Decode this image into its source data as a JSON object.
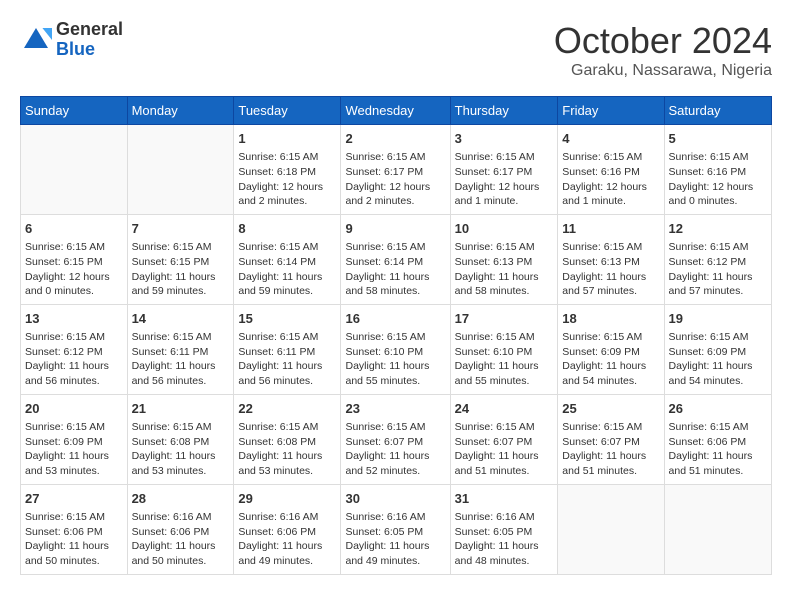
{
  "header": {
    "logo_general": "General",
    "logo_blue": "Blue",
    "title": "October 2024",
    "location": "Garaku, Nassarawa, Nigeria"
  },
  "days_of_week": [
    "Sunday",
    "Monday",
    "Tuesday",
    "Wednesday",
    "Thursday",
    "Friday",
    "Saturday"
  ],
  "weeks": [
    [
      {
        "day": "",
        "sunrise": "",
        "sunset": "",
        "daylight": "",
        "empty": true
      },
      {
        "day": "",
        "sunrise": "",
        "sunset": "",
        "daylight": "",
        "empty": true
      },
      {
        "day": "1",
        "sunrise": "Sunrise: 6:15 AM",
        "sunset": "Sunset: 6:18 PM",
        "daylight": "Daylight: 12 hours and 2 minutes."
      },
      {
        "day": "2",
        "sunrise": "Sunrise: 6:15 AM",
        "sunset": "Sunset: 6:17 PM",
        "daylight": "Daylight: 12 hours and 2 minutes."
      },
      {
        "day": "3",
        "sunrise": "Sunrise: 6:15 AM",
        "sunset": "Sunset: 6:17 PM",
        "daylight": "Daylight: 12 hours and 1 minute."
      },
      {
        "day": "4",
        "sunrise": "Sunrise: 6:15 AM",
        "sunset": "Sunset: 6:16 PM",
        "daylight": "Daylight: 12 hours and 1 minute."
      },
      {
        "day": "5",
        "sunrise": "Sunrise: 6:15 AM",
        "sunset": "Sunset: 6:16 PM",
        "daylight": "Daylight: 12 hours and 0 minutes."
      }
    ],
    [
      {
        "day": "6",
        "sunrise": "Sunrise: 6:15 AM",
        "sunset": "Sunset: 6:15 PM",
        "daylight": "Daylight: 12 hours and 0 minutes."
      },
      {
        "day": "7",
        "sunrise": "Sunrise: 6:15 AM",
        "sunset": "Sunset: 6:15 PM",
        "daylight": "Daylight: 11 hours and 59 minutes."
      },
      {
        "day": "8",
        "sunrise": "Sunrise: 6:15 AM",
        "sunset": "Sunset: 6:14 PM",
        "daylight": "Daylight: 11 hours and 59 minutes."
      },
      {
        "day": "9",
        "sunrise": "Sunrise: 6:15 AM",
        "sunset": "Sunset: 6:14 PM",
        "daylight": "Daylight: 11 hours and 58 minutes."
      },
      {
        "day": "10",
        "sunrise": "Sunrise: 6:15 AM",
        "sunset": "Sunset: 6:13 PM",
        "daylight": "Daylight: 11 hours and 58 minutes."
      },
      {
        "day": "11",
        "sunrise": "Sunrise: 6:15 AM",
        "sunset": "Sunset: 6:13 PM",
        "daylight": "Daylight: 11 hours and 57 minutes."
      },
      {
        "day": "12",
        "sunrise": "Sunrise: 6:15 AM",
        "sunset": "Sunset: 6:12 PM",
        "daylight": "Daylight: 11 hours and 57 minutes."
      }
    ],
    [
      {
        "day": "13",
        "sunrise": "Sunrise: 6:15 AM",
        "sunset": "Sunset: 6:12 PM",
        "daylight": "Daylight: 11 hours and 56 minutes."
      },
      {
        "day": "14",
        "sunrise": "Sunrise: 6:15 AM",
        "sunset": "Sunset: 6:11 PM",
        "daylight": "Daylight: 11 hours and 56 minutes."
      },
      {
        "day": "15",
        "sunrise": "Sunrise: 6:15 AM",
        "sunset": "Sunset: 6:11 PM",
        "daylight": "Daylight: 11 hours and 56 minutes."
      },
      {
        "day": "16",
        "sunrise": "Sunrise: 6:15 AM",
        "sunset": "Sunset: 6:10 PM",
        "daylight": "Daylight: 11 hours and 55 minutes."
      },
      {
        "day": "17",
        "sunrise": "Sunrise: 6:15 AM",
        "sunset": "Sunset: 6:10 PM",
        "daylight": "Daylight: 11 hours and 55 minutes."
      },
      {
        "day": "18",
        "sunrise": "Sunrise: 6:15 AM",
        "sunset": "Sunset: 6:09 PM",
        "daylight": "Daylight: 11 hours and 54 minutes."
      },
      {
        "day": "19",
        "sunrise": "Sunrise: 6:15 AM",
        "sunset": "Sunset: 6:09 PM",
        "daylight": "Daylight: 11 hours and 54 minutes."
      }
    ],
    [
      {
        "day": "20",
        "sunrise": "Sunrise: 6:15 AM",
        "sunset": "Sunset: 6:09 PM",
        "daylight": "Daylight: 11 hours and 53 minutes."
      },
      {
        "day": "21",
        "sunrise": "Sunrise: 6:15 AM",
        "sunset": "Sunset: 6:08 PM",
        "daylight": "Daylight: 11 hours and 53 minutes."
      },
      {
        "day": "22",
        "sunrise": "Sunrise: 6:15 AM",
        "sunset": "Sunset: 6:08 PM",
        "daylight": "Daylight: 11 hours and 53 minutes."
      },
      {
        "day": "23",
        "sunrise": "Sunrise: 6:15 AM",
        "sunset": "Sunset: 6:07 PM",
        "daylight": "Daylight: 11 hours and 52 minutes."
      },
      {
        "day": "24",
        "sunrise": "Sunrise: 6:15 AM",
        "sunset": "Sunset: 6:07 PM",
        "daylight": "Daylight: 11 hours and 51 minutes."
      },
      {
        "day": "25",
        "sunrise": "Sunrise: 6:15 AM",
        "sunset": "Sunset: 6:07 PM",
        "daylight": "Daylight: 11 hours and 51 minutes."
      },
      {
        "day": "26",
        "sunrise": "Sunrise: 6:15 AM",
        "sunset": "Sunset: 6:06 PM",
        "daylight": "Daylight: 11 hours and 51 minutes."
      }
    ],
    [
      {
        "day": "27",
        "sunrise": "Sunrise: 6:15 AM",
        "sunset": "Sunset: 6:06 PM",
        "daylight": "Daylight: 11 hours and 50 minutes."
      },
      {
        "day": "28",
        "sunrise": "Sunrise: 6:16 AM",
        "sunset": "Sunset: 6:06 PM",
        "daylight": "Daylight: 11 hours and 50 minutes."
      },
      {
        "day": "29",
        "sunrise": "Sunrise: 6:16 AM",
        "sunset": "Sunset: 6:06 PM",
        "daylight": "Daylight: 11 hours and 49 minutes."
      },
      {
        "day": "30",
        "sunrise": "Sunrise: 6:16 AM",
        "sunset": "Sunset: 6:05 PM",
        "daylight": "Daylight: 11 hours and 49 minutes."
      },
      {
        "day": "31",
        "sunrise": "Sunrise: 6:16 AM",
        "sunset": "Sunset: 6:05 PM",
        "daylight": "Daylight: 11 hours and 48 minutes."
      },
      {
        "day": "",
        "sunrise": "",
        "sunset": "",
        "daylight": "",
        "empty": true
      },
      {
        "day": "",
        "sunrise": "",
        "sunset": "",
        "daylight": "",
        "empty": true
      }
    ]
  ]
}
